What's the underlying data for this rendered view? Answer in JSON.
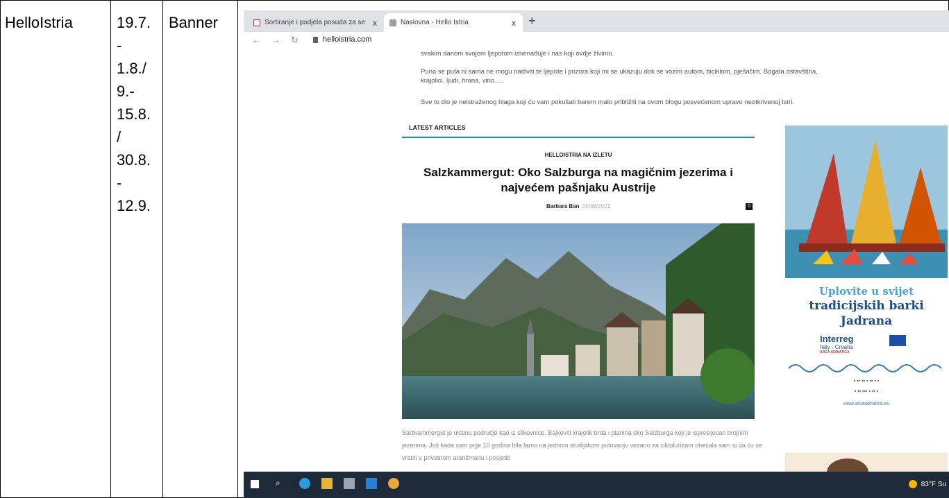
{
  "document_table": {
    "col1": "HelloIstria",
    "col2": "19.7.\n-\n1.8./\n9.-\n15.8.\n/\n30.8.\n-\n12.9.",
    "col3": "Banner"
  },
  "browser": {
    "tabs": [
      {
        "label": "Sortiranje i podjela posuda za se",
        "active": false,
        "icon": "gmail-icon"
      },
      {
        "label": "Naslovna - Hello Istria",
        "active": true,
        "icon": "site-favicon"
      }
    ],
    "new_tab_label": "+",
    "close_label": "x",
    "url": "helloistria.com"
  },
  "page": {
    "intro_line1": "svakim danom svojom ljepotom iznenađuje i nas koji ovdje živimo.",
    "intro_line2a": "Puno se puta ni sama ne mogu nadiviti te ljepote i prizora koji mi se ukazuju dok se vozim autom, biciklom, pješačim. Bogata ostavština,",
    "intro_line2b": "krajolici, ljudi, hrana, vino.....",
    "intro_line3": "Sve to dio je neistraženog blaga koji ću vam pokušati barem malo približiti na ovom blogu posvećenom upravo neotkrivenoj Istri.",
    "section_title": "LATEST ARTICLES",
    "article": {
      "category": "HELLOISTRIA NA IZLETU",
      "title": "Salzkammergut: Oko Salzburga na magičnim jezerima i najvećem pašnjaku Austrije",
      "author": "Barbara Ban",
      "date": "05/08/2021",
      "comments": "0",
      "excerpt": "Salzkammergut je uistinu područje kao iz slikovnice. Bajkoviti krajolik brda i planina oko Salzburga koji je ispresijecan brojnim jezerima. Još kada sam prije 10 godina bila tamo na jednom studijskom putovanju vezano za cikloturizam obećala sam si da ću se vratiti u privatnom aranžmanu i posjetiti"
    },
    "ad": {
      "line1": "Uplovite u svijet",
      "line2": "tradicijskih barki",
      "line3": "Jadrana",
      "brand": "Interreg",
      "brand_sub": "Italy - Croatia",
      "brand_sub2": "ARCA ADRIATICA",
      "website": "www.arcaadriatica.eu"
    }
  },
  "taskbar": {
    "weather": "83°F Su"
  }
}
